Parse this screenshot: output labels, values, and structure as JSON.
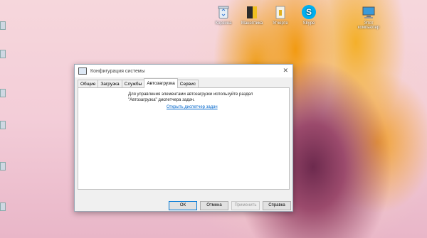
{
  "desktop": {
    "icons": [
      {
        "label": "Корзина",
        "icon": "recycle-bin-icon"
      },
      {
        "label": "Манэптика",
        "icon": "document-icon"
      },
      {
        "label": "Угчерте",
        "icon": "folder-icon"
      },
      {
        "label": "Skype",
        "icon": "skype-icon"
      },
      {
        "label": "Этот компьютер",
        "icon": "computer-icon"
      }
    ]
  },
  "dialog": {
    "title": "Конфигурация системы",
    "tabs": [
      "Общие",
      "Загрузка",
      "Службы",
      "Автозагрузка",
      "Сервис"
    ],
    "active_tab": "Автозагрузка",
    "description": "Для управления элементами автозагрузки используйте раздел \"Автозагрузка\" диспетчера задач.",
    "link": "Открыть диспетчер задач",
    "buttons": {
      "ok": "ОК",
      "cancel": "Отмена",
      "apply": "Применить",
      "help": "Справка"
    }
  }
}
